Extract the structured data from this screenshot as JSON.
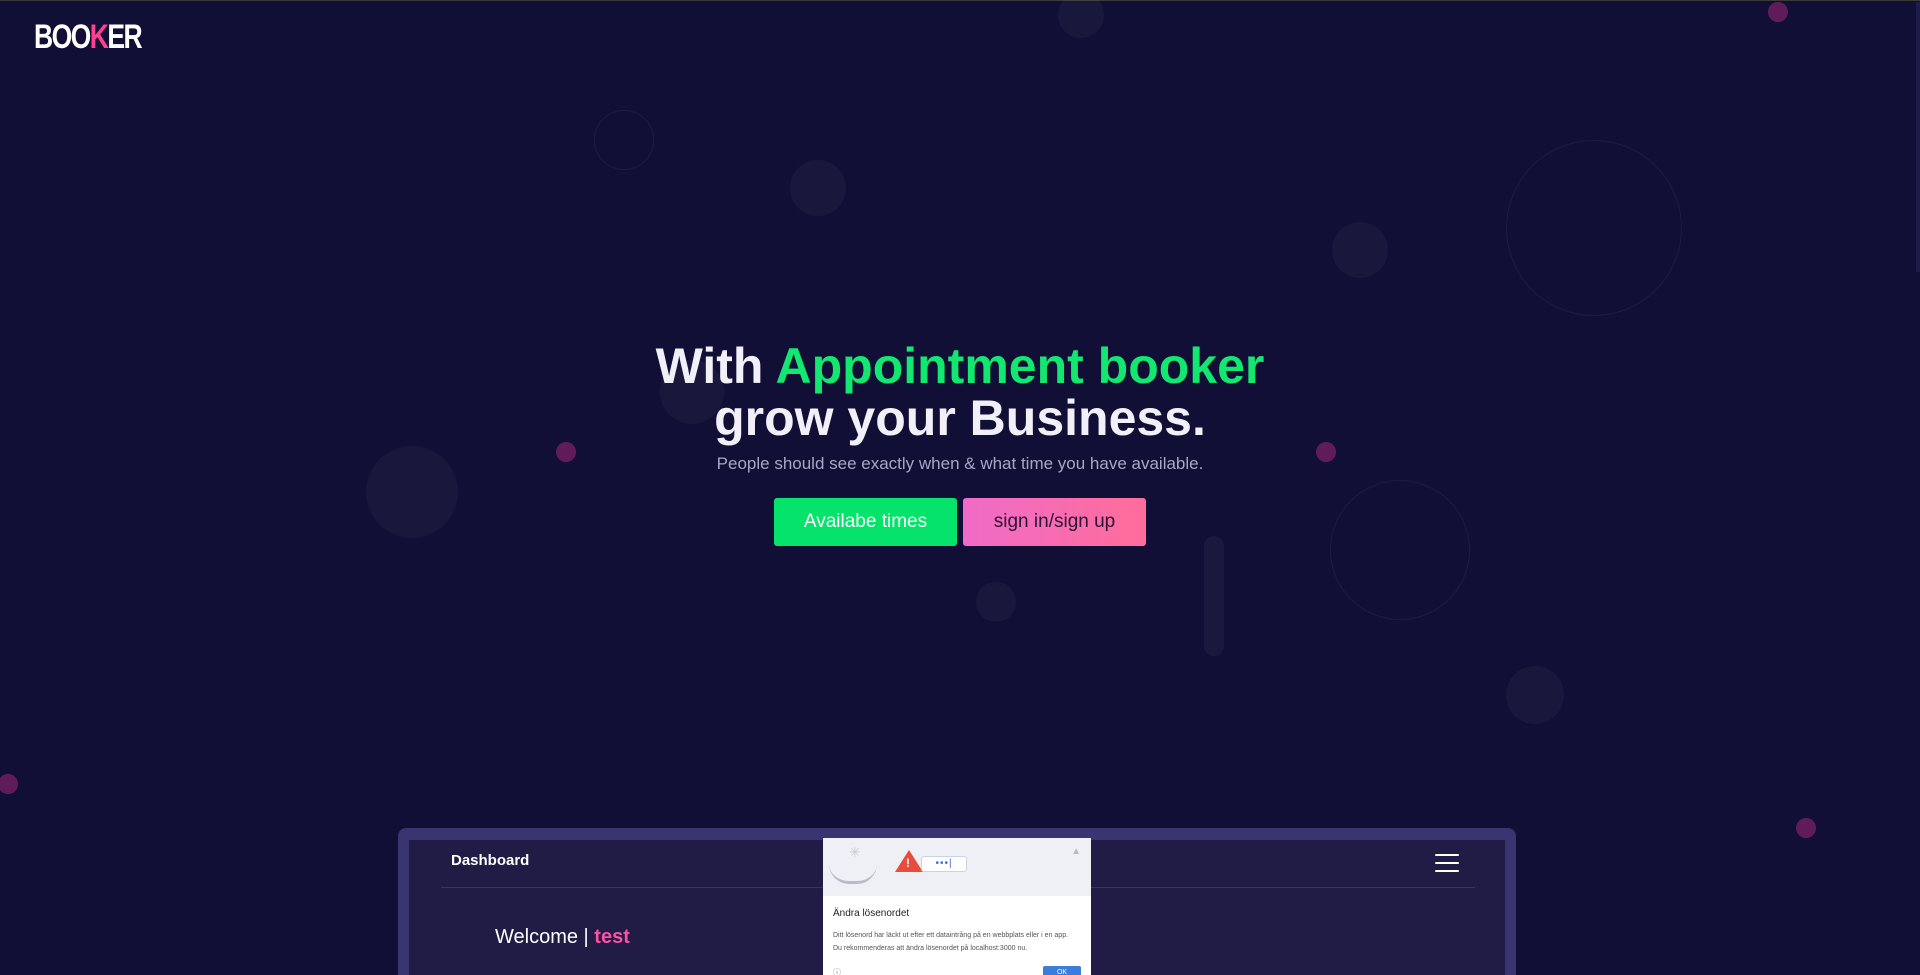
{
  "brand": {
    "logo_pre": "BOO",
    "logo_hl": "K",
    "logo_post": "ER"
  },
  "hero": {
    "line1_pre": "With ",
    "line1_accent": "Appointment booker",
    "line2": "grow your Business.",
    "subtitle": "People should see exactly when & what time you have available.",
    "btn_available": "Availabe times",
    "btn_signin": "sign in/sign up"
  },
  "preview": {
    "dashboard_title": "Dashboard",
    "welcome_label": "Welcome | ",
    "username": "test"
  },
  "password_popup": {
    "title": "Ändra lösenordet",
    "body_line1": "Ditt lösenord har läckt ut efter ett dataintrång på en webbplats eller i en app.",
    "body_line2": "Du rekommenderas att ändra lösenordet på localhost:3000 nu.",
    "pw_mask": "•••|",
    "ok_label": "OK"
  },
  "colors": {
    "background": "#120f36",
    "accent_green": "#12e86f",
    "accent_pink": "#ff3f8f"
  }
}
